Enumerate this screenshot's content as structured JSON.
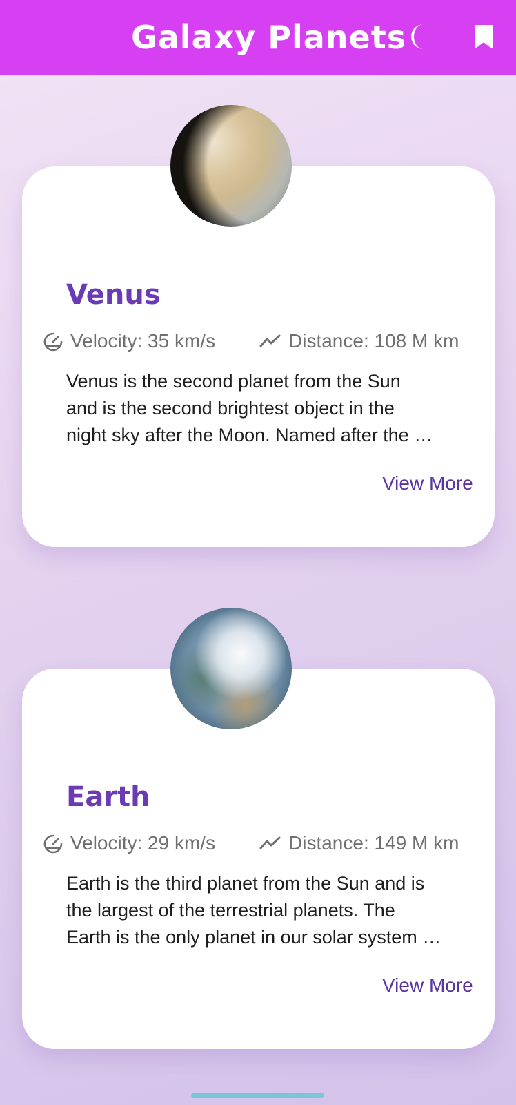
{
  "app": {
    "title": "Galaxy Planets",
    "bar_color": "#d63ff2",
    "icons": [
      "moon-icon",
      "bookmark-icon"
    ]
  },
  "planets": [
    {
      "name": "Venus",
      "velocity": "Velocity: 35 km/s",
      "distance": "Distance: 108 M km",
      "description": "Venus is the second planet from the Sun\nand is the second brightest object in the\nnight sky after the Moon. Named after the …",
      "action": "View More"
    },
    {
      "name": "Earth",
      "velocity": "Velocity: 29 km/s",
      "distance": "Distance: 149 M km",
      "description": "Earth is the third planet from the Sun and is\nthe largest of the terrestrial planets. The\nEarth is the only planet in our solar system …",
      "action": "View More"
    }
  ],
  "colors": {
    "accent": "#6b3bb5",
    "link": "#5b34a3"
  }
}
